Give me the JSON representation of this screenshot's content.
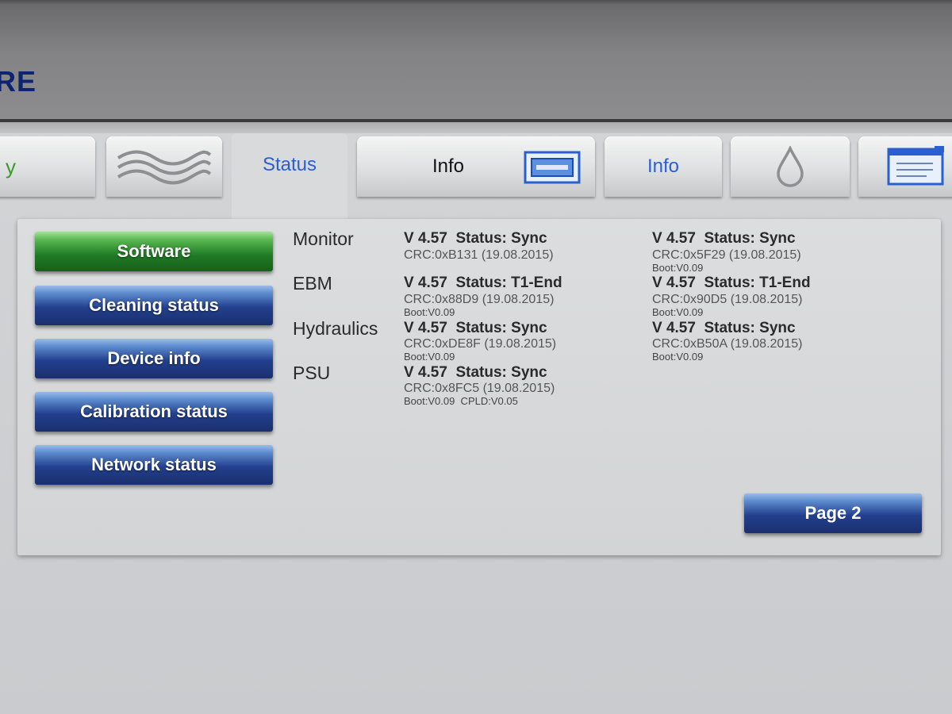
{
  "header": {
    "title": "RE"
  },
  "tabs": [
    {
      "label": "y",
      "color": "#3c9a2a"
    },
    {
      "icon": "waves-icon"
    },
    {
      "label": "Status",
      "active": true,
      "color": "#2a5fd0"
    },
    {
      "label": "Info",
      "icon": "card-slot-icon",
      "color": "#111111"
    },
    {
      "label": "Info",
      "color": "#2a5fd0"
    },
    {
      "icon": "drop-icon"
    },
    {
      "icon": "document-icon"
    }
  ],
  "sidebar": {
    "items": [
      {
        "label": "Software",
        "selected": true
      },
      {
        "label": "Cleaning status"
      },
      {
        "label": "Device info"
      },
      {
        "label": "Calibration status"
      },
      {
        "label": "Network status"
      }
    ]
  },
  "modules": [
    {
      "name": "Monitor",
      "col1": {
        "version": "V 4.57  Status: Sync",
        "crc": "CRC:0xB131 (19.08.2015)",
        "boot": ""
      },
      "col2": {
        "version": "V 4.57  Status: Sync",
        "crc": "CRC:0x5F29 (19.08.2015)",
        "boot": "Boot:V0.09"
      }
    },
    {
      "name": "EBM",
      "col1": {
        "version": "V 4.57  Status: T1-End",
        "crc": "CRC:0x88D9 (19.08.2015)",
        "boot": "Boot:V0.09"
      },
      "col2": {
        "version": "V 4.57  Status: T1-End",
        "crc": "CRC:0x90D5 (19.08.2015)",
        "boot": "Boot:V0.09"
      }
    },
    {
      "name": "Hydraulics",
      "col1": {
        "version": "V 4.57  Status: Sync",
        "crc": "CRC:0xDE8F (19.08.2015)",
        "boot": "Boot:V0.09"
      },
      "col2": {
        "version": "V 4.57  Status: Sync",
        "crc": "CRC:0xB50A (19.08.2015)",
        "boot": "Boot:V0.09"
      }
    },
    {
      "name": "PSU",
      "col1": {
        "version": "V 4.57  Status: Sync",
        "crc": "CRC:0x8FC5 (19.08.2015)",
        "boot": "Boot:V0.09  CPLD:V0.05"
      },
      "col2": {
        "version": "",
        "crc": "",
        "boot": ""
      }
    }
  ],
  "page_button": {
    "label": "Page 2"
  },
  "colors": {
    "accent_blue": "#23408e",
    "selected_green": "#1f7a24",
    "tab_text_blue": "#2a5fd0"
  }
}
